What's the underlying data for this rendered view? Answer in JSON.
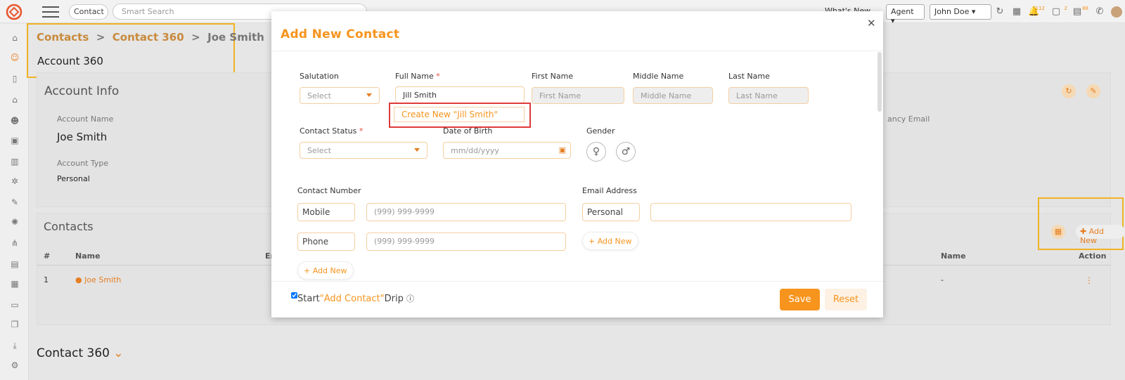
{
  "topbar": {
    "context_select": "Contact",
    "search_placeholder": "Smart Search",
    "whats_new": "What's New",
    "agent_select": "Agent",
    "user_select": "John Doe",
    "badges": {
      "notifications": "112",
      "messages": "2",
      "tasks": "88"
    }
  },
  "breadcrumb": {
    "item1": "Contacts",
    "sep": ">",
    "item2": "Contact 360",
    "item3": "Joe Smith"
  },
  "page_title": "Account 360",
  "account_info": {
    "title": "Account Info",
    "account_name_label": "Account Name",
    "account_name": "Joe Smith",
    "account_type_label": "Account Type",
    "account_type": "Personal",
    "partial_label": "ancy Email"
  },
  "contacts": {
    "title": "Contacts",
    "add_new": "Add New",
    "columns": [
      "#",
      "Name",
      "Em",
      "Name",
      "Action"
    ],
    "rows": [
      {
        "num": "1",
        "name": "Joe Smith",
        "col2": "-"
      }
    ]
  },
  "contact360": "Contact 360",
  "modal": {
    "title": "Add New Contact",
    "salutation_label": "Salutation",
    "salutation_value": "Select",
    "fullname_label": "Full Name",
    "fullname_value": "Jill Smith",
    "suggestion": "Create New \"Jill Smith\"",
    "firstname_label": "First Name",
    "firstname_placeholder": "First Name",
    "middlename_label": "Middle Name",
    "middlename_placeholder": "Middle Name",
    "lastname_label": "Last Name",
    "lastname_placeholder": "Last Name",
    "status_label": "Contact Status",
    "status_value": "Select",
    "dob_label": "Date of Birth",
    "dob_placeholder": "mm/dd/yyyy",
    "gender_label": "Gender",
    "contact_number_label": "Contact Number",
    "mobile_type": "Mobile",
    "mobile_placeholder": "(999) 999-9999",
    "phone_type": "Phone",
    "phone_placeholder": "(999) 999-9999",
    "add_new_number": "+ Add New",
    "email_label": "Email Address",
    "email_type": "Personal",
    "add_new_email": "+ Add New",
    "drip_start": "Start",
    "drip_name": "\"Add Contact\"",
    "drip_end": "Drip",
    "save": "Save",
    "reset": "Reset"
  }
}
